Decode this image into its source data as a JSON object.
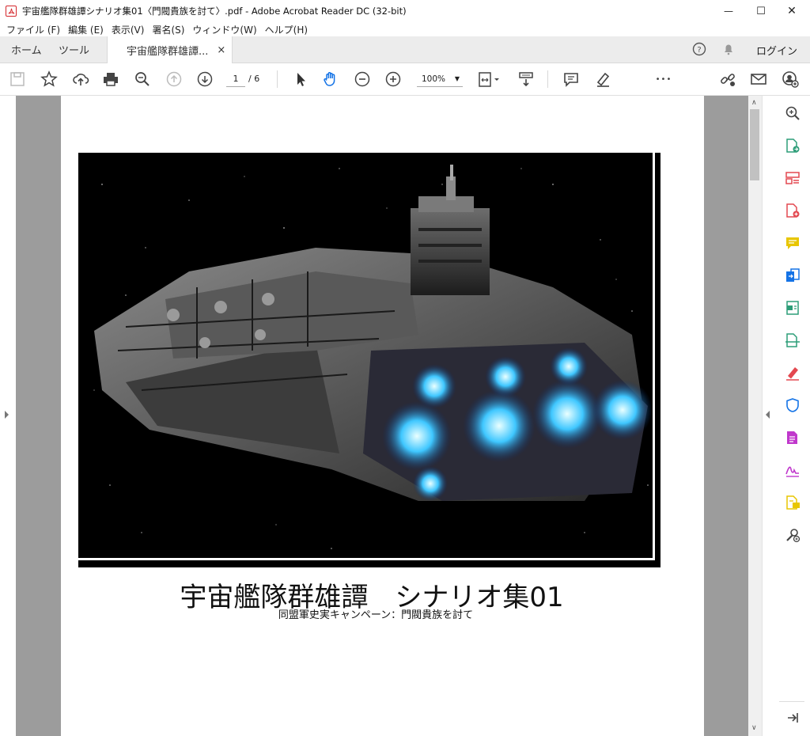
{
  "window": {
    "title": "宇宙艦隊群雄譚シナリオ集01〈門閥貴族を討て〉.pdf - Adobe Acrobat Reader DC (32-bit)",
    "minimize": "—",
    "maximize": "☐",
    "close": "✕"
  },
  "menu": [
    "ファイル (F)",
    "編集 (E)",
    "表示(V)",
    "署名(S)",
    "ウィンドウ(W)",
    "ヘルプ(H)"
  ],
  "tabs": {
    "home": "ホーム",
    "tools": "ツール",
    "document": "宇宙艦隊群雄譚...",
    "close": "×"
  },
  "header_right": {
    "login": "ログイン"
  },
  "toolbar": {
    "page_current": "1",
    "page_total": "/ 6",
    "zoom": "100%",
    "more": "•••"
  },
  "document": {
    "title": "宇宙艦隊群雄譚　シナリオ集01",
    "subtitle": "同盟軍史実キャンペーン：門閥貴族を討て"
  },
  "colors": {
    "acrobat_red": "#d4262b",
    "tool_blue": "#1473e6",
    "tool_green": "#2d9d78",
    "tool_pink": "#e34850",
    "tool_magenta": "#c038cc",
    "tool_yellow": "#e8c600",
    "engine_glow": "#3fc7ff"
  }
}
